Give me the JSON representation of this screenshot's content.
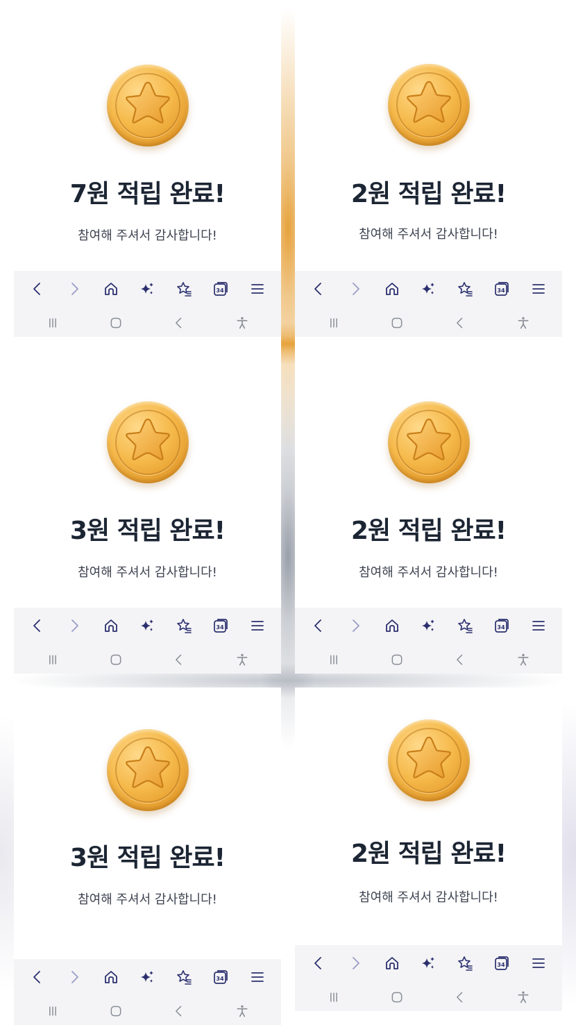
{
  "colors": {
    "coin": "#f2b445",
    "title": "#1c2533",
    "subtitle": "#3d4350",
    "nav_icon": "#2b2f6e",
    "nav_icon_disabled": "#9a9cc8",
    "system_icon": "#8a8d96",
    "toolbar_bg": "#f4f4f6"
  },
  "panels": [
    {
      "title": "7원 적립 완료!",
      "subtitle": "참여해 주셔서 감사합니다!"
    },
    {
      "title": "2원 적립 완료!",
      "subtitle": "참여해 주셔서 감사합니다!"
    },
    {
      "title": "3원 적립 완료!",
      "subtitle": "참여해 주셔서 감사합니다!"
    },
    {
      "title": "2원 적립 완료!",
      "subtitle": "참여해 주셔서 감사합니다!"
    },
    {
      "title": "3원 적립 완료!",
      "subtitle": "참여해 주셔서 감사합니다!"
    },
    {
      "title": "2원 적립 완료!",
      "subtitle": "참여해 주셔서 감사합니다!"
    }
  ],
  "browser_toolbar": {
    "tab_count": "34",
    "icons": [
      "back-icon",
      "forward-icon",
      "home-icon",
      "sparkle-icon",
      "bookmarks-icon",
      "tabs-icon",
      "menu-icon"
    ]
  },
  "system_nav": {
    "icons": [
      "recent-apps-icon",
      "home-circle-icon",
      "system-back-icon",
      "accessibility-icon"
    ]
  }
}
